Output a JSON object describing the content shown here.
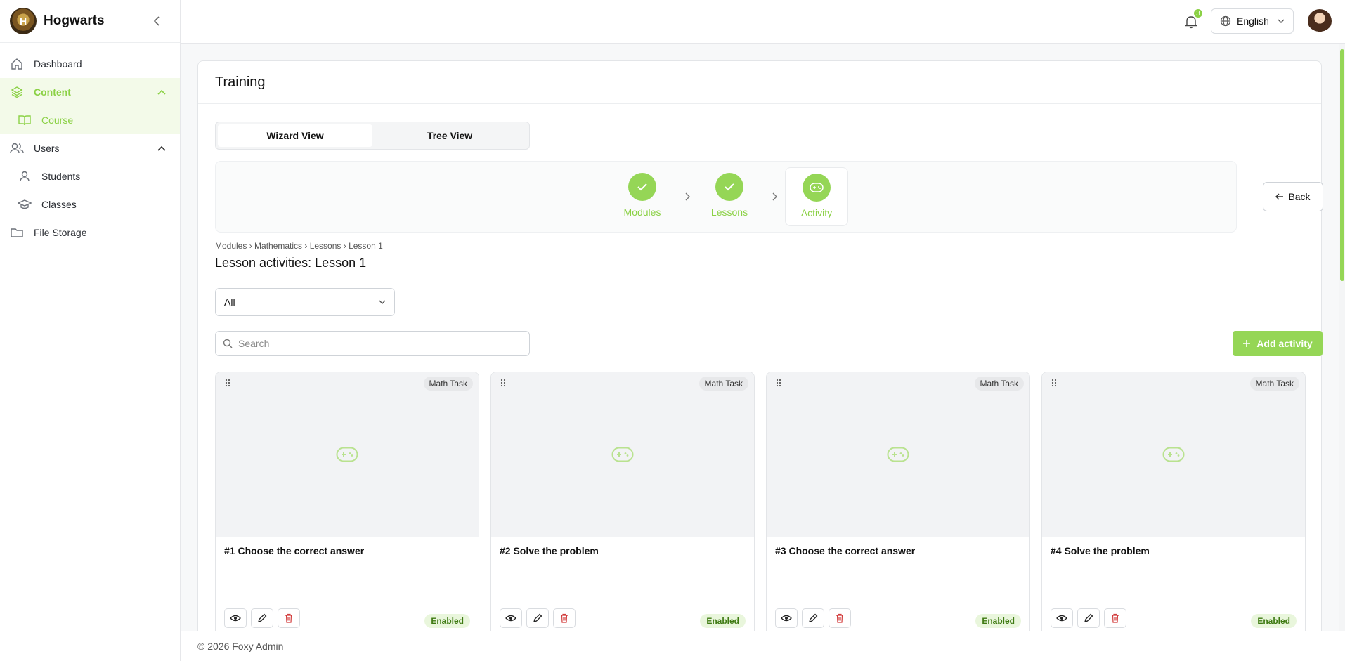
{
  "brand": {
    "name": "Hogwarts"
  },
  "sidebar": {
    "items": [
      {
        "label": "Dashboard"
      },
      {
        "label": "Content"
      },
      {
        "label": "Course"
      },
      {
        "label": "Users"
      },
      {
        "label": "Students"
      },
      {
        "label": "Classes"
      },
      {
        "label": "File Storage"
      }
    ]
  },
  "topbar": {
    "notifications_count": "3",
    "language": "English"
  },
  "page": {
    "title": "Training",
    "views": [
      "Wizard View",
      "Tree View"
    ],
    "steps": [
      "Modules",
      "Lessons",
      "Activity"
    ],
    "back_label": "Back",
    "breadcrumb": "Modules › Mathematics › Lessons › Lesson 1",
    "lesson_title": "Lesson activities: Lesson 1",
    "filter_value": "All",
    "search_placeholder": "Search",
    "add_label": "Add activity"
  },
  "activities": [
    {
      "title": "#1 Choose the correct answer",
      "tag": "Math Task",
      "status": "Enabled"
    },
    {
      "title": "#2 Solve the problem",
      "tag": "Math Task",
      "status": "Enabled"
    },
    {
      "title": "#3 Choose the correct answer",
      "tag": "Math Task",
      "status": "Enabled"
    },
    {
      "title": "#4 Solve the problem",
      "tag": "Math Task",
      "status": "Enabled"
    }
  ],
  "footer": {
    "text": "© 2026 Foxy Admin"
  },
  "colors": {
    "accent": "#95d656",
    "accent_text": "#8bd145",
    "enabled_bg": "#e9f6dc",
    "delete": "#d23b3b"
  }
}
